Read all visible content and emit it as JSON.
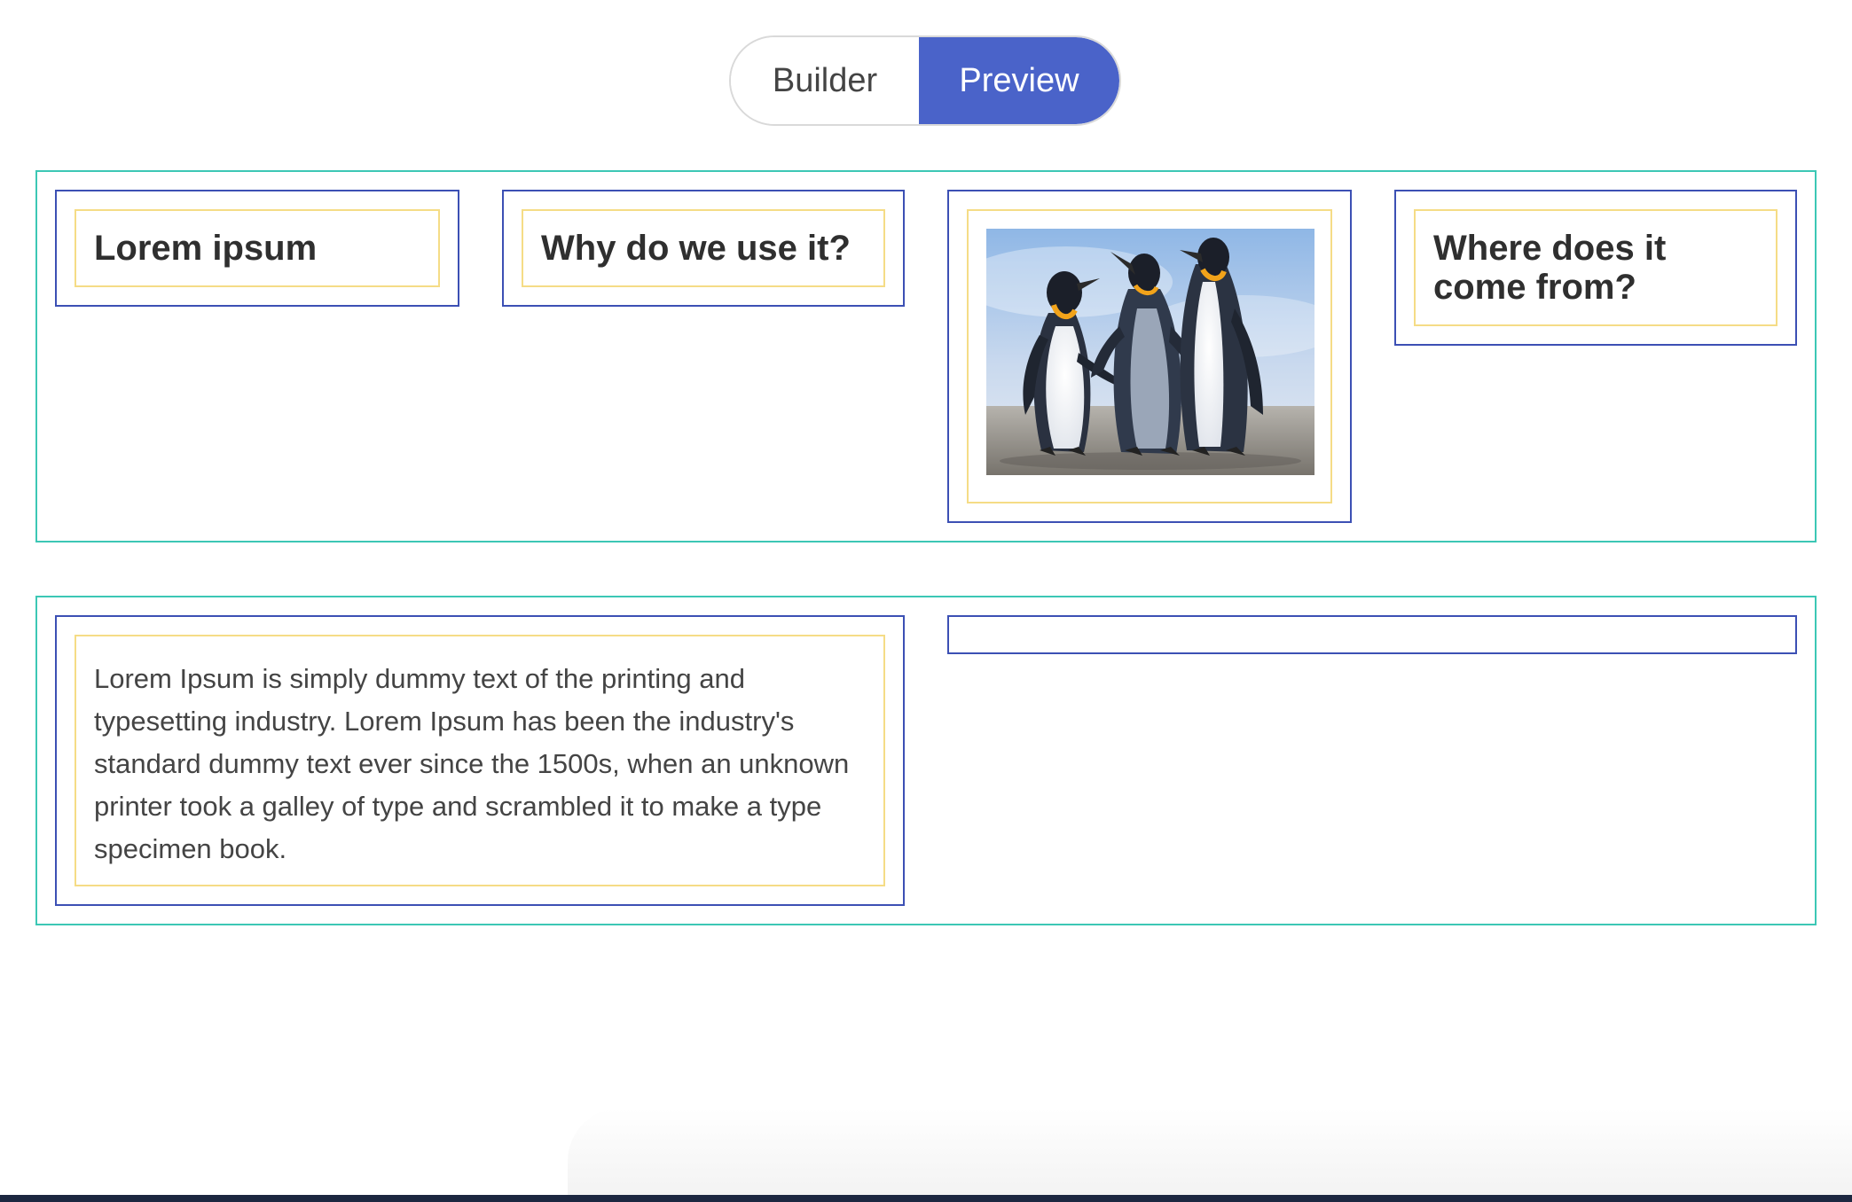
{
  "toggle": {
    "builder_label": "Builder",
    "preview_label": "Preview",
    "active": "Preview"
  },
  "row1": {
    "col1": {
      "heading": "Lorem ipsum"
    },
    "col2": {
      "heading": "Why do we use it?"
    },
    "col3": {
      "image": "penguins-image"
    },
    "col4": {
      "heading": "Where does it come from?"
    }
  },
  "row2": {
    "col1": {
      "text": "Lorem Ipsum is simply dummy text of the printing and typesetting industry. Lorem Ipsum has been the industry's standard dummy text ever since the 1500s, when an unknown printer took a galley of type and scrambled it to make a type specimen book."
    },
    "col2": {
      "text": ""
    }
  },
  "colors": {
    "row_border": "#3cc7b5",
    "column_border": "#3c50b4",
    "element_border": "#f5dc86",
    "accent": "#4a63c9"
  }
}
